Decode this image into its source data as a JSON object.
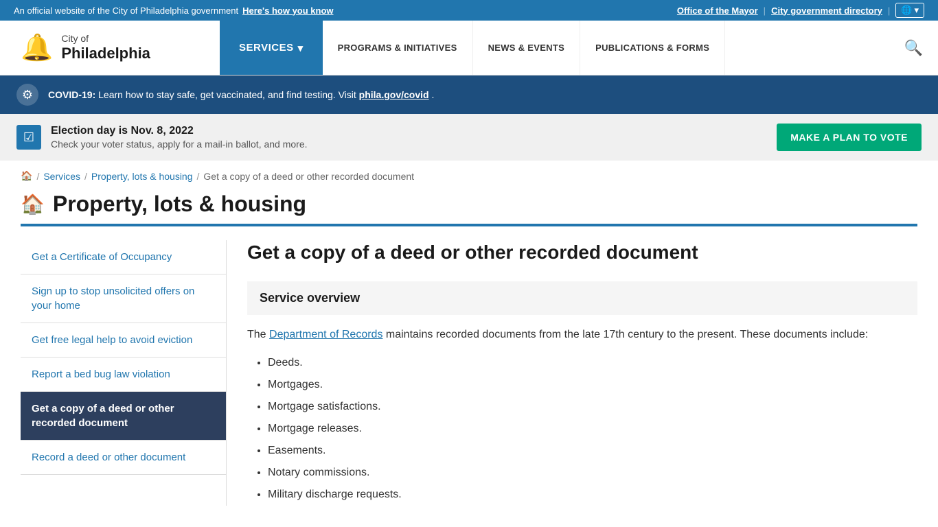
{
  "topBanner": {
    "officialText": "An official website of the City of Philadelphia government",
    "howToKnowText": "Here's how you know",
    "officeOfMayor": "Office of the Mayor",
    "cityGovDirectory": "City government directory"
  },
  "header": {
    "cityOf": "City of",
    "philadelphia": "Philadelphia",
    "servicesLabel": "SERVICES",
    "navLinks": [
      {
        "label": "PROGRAMS & INITIATIVES",
        "href": "#"
      },
      {
        "label": "NEWS & EVENTS",
        "href": "#"
      },
      {
        "label": "PUBLICATIONS & FORMS",
        "href": "#"
      }
    ]
  },
  "covidBanner": {
    "boldText": "COVID-19:",
    "text": "Learn how to stay safe, get vaccinated, and find testing. Visit",
    "linkText": "phila.gov/covid",
    "trailingDot": "."
  },
  "electionBanner": {
    "title": "Election day is Nov. 8, 2022",
    "subtitle": "Check your voter status, apply for a mail-in ballot, and more.",
    "buttonLabel": "MAKE A PLAN TO VOTE"
  },
  "breadcrumb": {
    "home": "Home",
    "services": "Services",
    "propertyLotsHousing": "Property, lots & housing",
    "current": "Get a copy of a deed or other recorded document"
  },
  "pageTitle": "Property, lots & housing",
  "sidebar": {
    "items": [
      {
        "label": "Get a Certificate of Occupancy",
        "active": false
      },
      {
        "label": "Sign up to stop unsolicited offers on your home",
        "active": false
      },
      {
        "label": "Get free legal help to avoid eviction",
        "active": false
      },
      {
        "label": "Report a bed bug law violation",
        "active": false
      },
      {
        "label": "Get a copy of a deed or other recorded document",
        "active": true
      },
      {
        "label": "Record a deed or other document",
        "active": false
      }
    ]
  },
  "content": {
    "title": "Get a copy of a deed or other recorded document",
    "serviceOverviewHeading": "Service overview",
    "intro": "The",
    "deptLink": "Department of Records",
    "introRest": "maintains recorded documents from the late 17th century to the present. These documents include:",
    "listItems": [
      "Deeds.",
      "Mortgages.",
      "Mortgage satisfactions.",
      "Mortgage releases.",
      "Easements.",
      "Notary commissions.",
      "Military discharge requests."
    ]
  }
}
